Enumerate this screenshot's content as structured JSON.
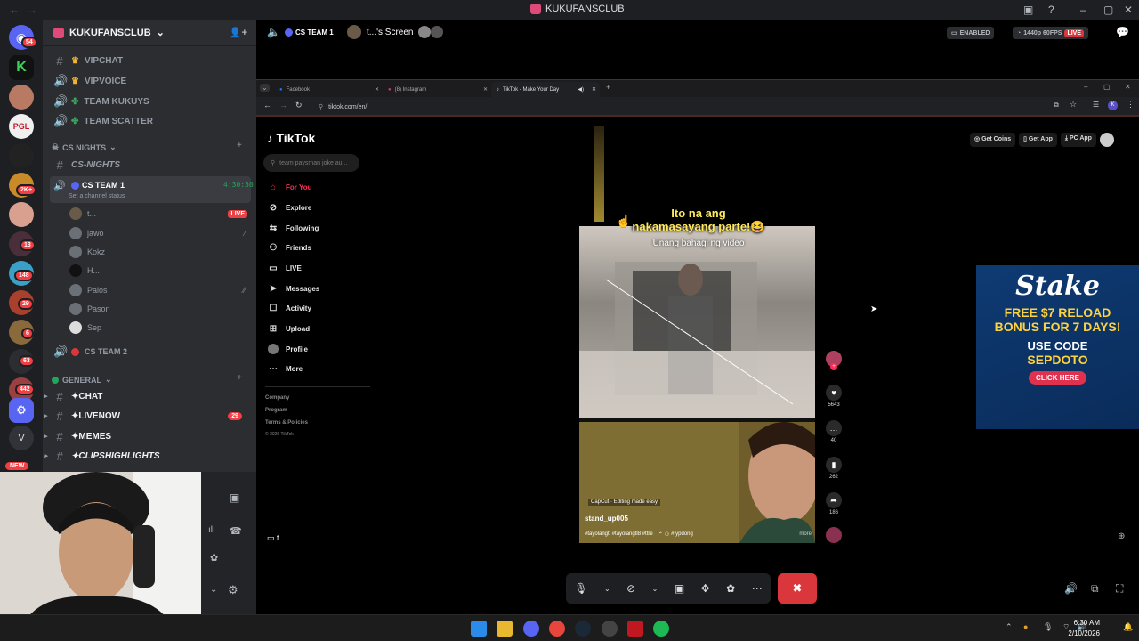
{
  "window": {
    "title": "KUKUFANSCLUB"
  },
  "rail_badges": [
    "54",
    "2K+",
    "13",
    "148",
    "29",
    "6",
    "63",
    "442"
  ],
  "rail_letter": "V",
  "rail_new": "NEW",
  "server": {
    "name": "KUKUFANSCLUB",
    "top_channels": [
      "VIPCHAT",
      "VIPVOICE",
      "TEAM KUKUYS",
      "TEAM SCATTER"
    ],
    "category_cs": "CS NIGHTS",
    "cs_nights_channel": "CS-NIGHTS",
    "voice_channel": {
      "name": "CS TEAM 1",
      "timer": "4:30:30",
      "status_hint": "Set a channel status"
    },
    "users": [
      {
        "name": "t...",
        "live": "LIVE"
      },
      {
        "name": "jawo"
      },
      {
        "name": "Kokz"
      },
      {
        "name": "H..."
      },
      {
        "name": "Palos"
      },
      {
        "name": "Pason"
      },
      {
        "name": "Sep"
      }
    ],
    "voice_channel2": "CS TEAM 2",
    "category_general": "GENERAL",
    "general_channels": [
      {
        "name": "✦CHAT"
      },
      {
        "name": "✦LIVENOW",
        "badge": "29"
      },
      {
        "name": "✦MEMES"
      },
      {
        "name": "✦CLIPSHIGHLIGHTS"
      }
    ]
  },
  "stream_header": {
    "channel": "CS TEAM 1",
    "screen": "t...'s Screen",
    "enabled": "ENABLED",
    "quality": "1440p 60FPS",
    "live": "LIVE",
    "viewer_label": "t..."
  },
  "browser": {
    "tabs": [
      {
        "label": "Facebook"
      },
      {
        "label": "(8) Instagram"
      },
      {
        "label": "TikTok - Make Your Day"
      }
    ],
    "url": "tiktok.com/en/"
  },
  "tiktok": {
    "logo": "TikTok",
    "search_placeholder": "team paysman joke au...",
    "nav": [
      "For You",
      "Explore",
      "Following",
      "Friends",
      "LIVE",
      "Messages",
      "Activity",
      "Upload",
      "Profile",
      "More"
    ],
    "footer": [
      "Company",
      "Program",
      "Terms & Policies",
      "© 2026 TikTok"
    ],
    "top_buttons": [
      "Get Coins",
      "Get App",
      "PC App"
    ],
    "video": {
      "caption_line1": "Ito na ang",
      "caption_line2": "nakamasayang parte!😆",
      "caption_sub": "Unang bahagi ng video",
      "capcut": "CapCut · Editing made easy",
      "author": "stand_up005",
      "hashtags": "#tayolangtl #tayolangtl8 #ttre",
      "hashtag2": "#fypdong",
      "more": "more"
    },
    "actions": {
      "likes": "5643",
      "comments": "40",
      "saves": "262",
      "shares": "186"
    }
  },
  "ad": {
    "brand": "Stake",
    "line1": "FREE $7 RELOAD",
    "line2": "BONUS FOR 7 DAYS!",
    "code_label": "USE CODE",
    "code": "SEPDOTO",
    "cta": "CLICK HERE"
  },
  "clock": {
    "time": "6:30 AM",
    "date": "2/10/2026"
  }
}
